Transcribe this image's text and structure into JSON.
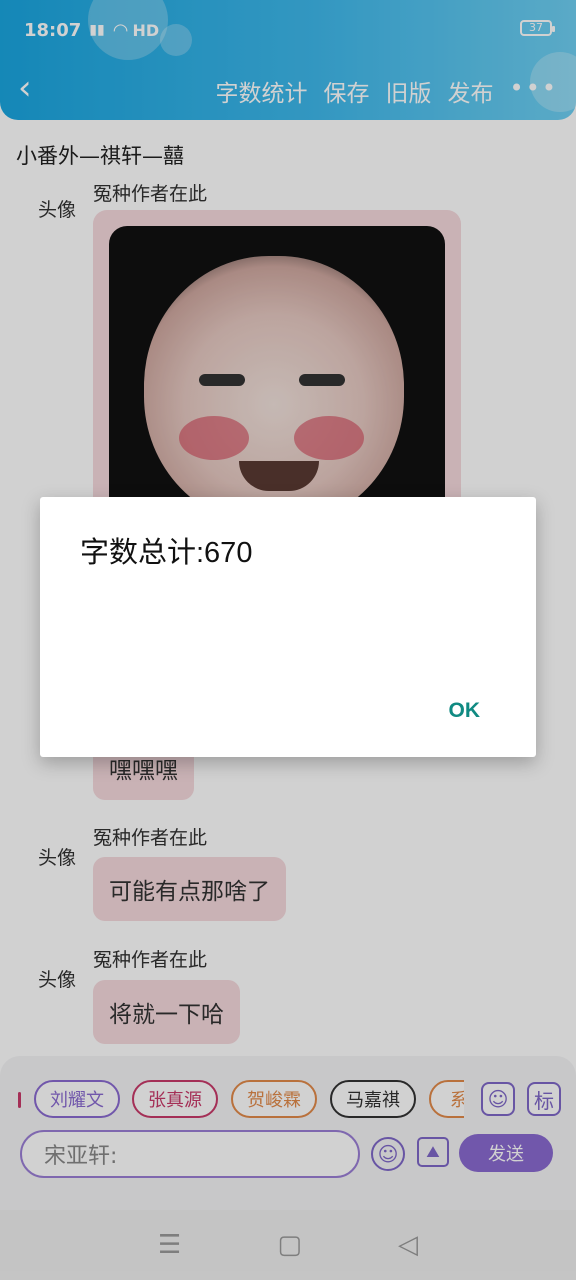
{
  "status": {
    "time": "18:07",
    "hd": "HD",
    "battery": "37"
  },
  "header": {
    "actions": [
      "字数统计",
      "保存",
      "旧版",
      "发布"
    ],
    "more": "•••"
  },
  "doc_title": "小番外—祺轩—囍",
  "chat": {
    "avatar_label": "头像",
    "author": "冤种作者在此",
    "messages": [
      "嘿嘿嘿",
      "可能有点那啥了",
      "将就一下哈"
    ]
  },
  "chips": [
    "刘耀文",
    "张真源",
    "贺峻霖",
    "马嘉祺",
    "系"
  ],
  "chip_colors": [
    "#8a6bd1",
    "#c93a6a",
    "#e28a4a",
    "#333333",
    "#e28a4a"
  ],
  "tools": {
    "tag_label": "标"
  },
  "input": {
    "placeholder": "宋亚轩:"
  },
  "send_label": "发送",
  "dialog": {
    "title": "字数总计:670",
    "ok": "OK"
  },
  "sysnav": {
    "menu": "☰",
    "home": "▢",
    "back": "◁"
  }
}
